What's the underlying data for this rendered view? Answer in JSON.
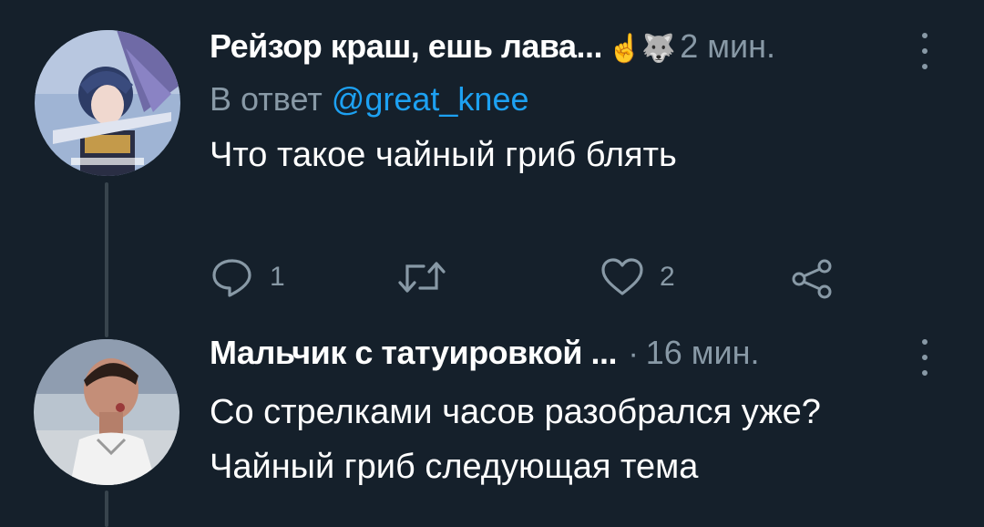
{
  "tweets": [
    {
      "author": "Рейзор краш, ешь лава...",
      "emoji": "☝️🐺",
      "time": "2 мин.",
      "reply_prefix": "В ответ",
      "reply_to": "@great_knee",
      "text": "Что такое чайный гриб блять",
      "replies": "1",
      "retweets": "",
      "likes": "2"
    },
    {
      "author": "Мальчик с татуировкой ...",
      "separator": "·",
      "time": "16 мин.",
      "text_line1": "Со стрелками часов разобрался уже?",
      "text_line2": "Чайный гриб следующая тема"
    }
  ],
  "icons": [
    "reply-icon",
    "retweet-icon",
    "like-icon",
    "share-icon",
    "more-icon"
  ],
  "colors": {
    "background": "#15202b",
    "secondary_text": "#8899a6",
    "link": "#1da1f2",
    "thread_line": "#38444d"
  }
}
